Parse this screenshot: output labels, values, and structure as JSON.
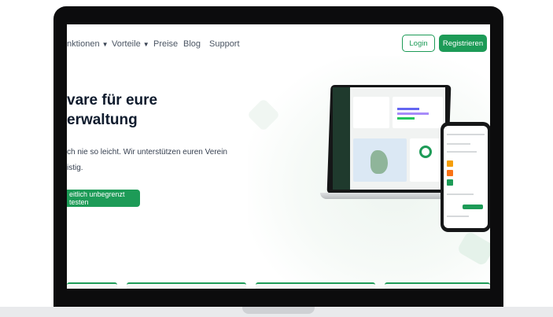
{
  "nav": {
    "items": [
      {
        "label": "nktionen",
        "has_chevron": true
      },
      {
        "label": "Vorteile",
        "has_chevron": true
      },
      {
        "label": "Preise"
      },
      {
        "label": "Blog"
      },
      {
        "label": "Support"
      }
    ],
    "login_label": "Login",
    "register_label": "Registrieren"
  },
  "hero": {
    "title_line1": "vare für eure",
    "title_line2": "erwaltung",
    "text_line1": "ch nie so leicht. Wir unterstützen euren Verein",
    "text_line2": "istig.",
    "cta_label": "eitlich unbegrenzt testen"
  },
  "colors": {
    "accent": "#1d9b57",
    "heading": "#0f1b2d",
    "laptop_frame": "#0c0c0d"
  },
  "icons": {
    "chevron": "chevron-down-icon"
  }
}
